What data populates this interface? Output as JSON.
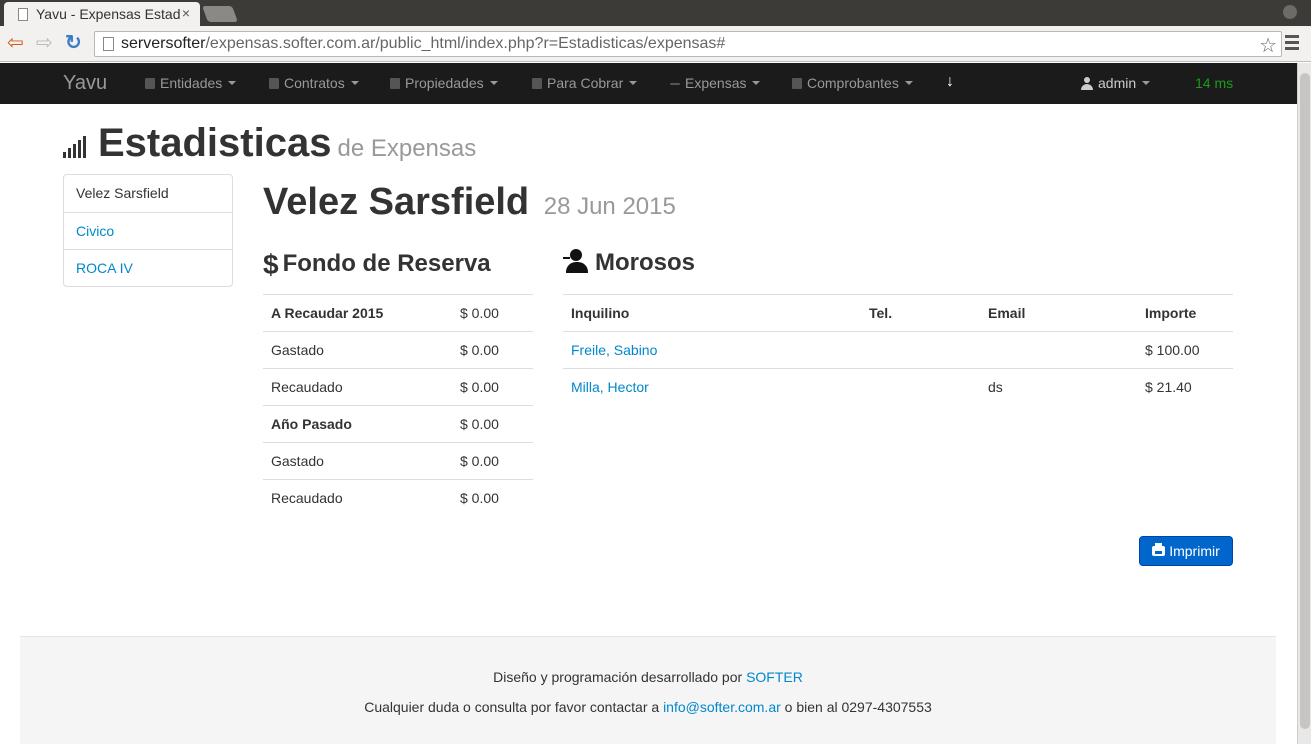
{
  "browser": {
    "tab_title": "Yavu - Expensas Estadisticas",
    "tab_close": "×",
    "url_host": "serversofter",
    "url_path": "/expensas.softer.com.ar/public_html/index.php?r=Estadisticas/expensas#",
    "back_icon": "arrow-left-icon",
    "forward_icon": "arrow-right-icon",
    "reload_icon": "reload-icon",
    "star_icon": "star-icon",
    "star_glyph": "☆",
    "back_glyph": "⇦",
    "forward_glyph": "⇨",
    "reload_glyph": "↻"
  },
  "navbar": {
    "brand": "Yavu",
    "items": [
      {
        "label": "Entidades"
      },
      {
        "label": "Contratos"
      },
      {
        "label": "Propiedades"
      },
      {
        "label": "Para Cobrar"
      },
      {
        "label": "Expensas"
      },
      {
        "label": "Comprobantes"
      }
    ],
    "download_glyph": "↓",
    "user": "admin",
    "timing": "14 ms",
    "colors": {
      "background": "#1b1b1b",
      "timing": "#1a9c1a"
    }
  },
  "page": {
    "title": "Estadisticas",
    "subtitle": "de Expensas"
  },
  "sidebar": {
    "items": [
      {
        "label": "Velez Sarsfield"
      },
      {
        "label": "Civico"
      },
      {
        "label": "ROCA IV"
      }
    ]
  },
  "main": {
    "building": "Velez Sarsfield",
    "date": "28 Jun 2015",
    "fondo": {
      "title": "Fondo de Reserva",
      "rows": [
        {
          "label": "A Recaudar 2015",
          "value": "$ 0.00"
        },
        {
          "label": "Gastado",
          "value": "$ 0.00"
        },
        {
          "label": "Recaudado",
          "value": "$ 0.00"
        },
        {
          "label": "Año Pasado",
          "value": "$ 0.00"
        },
        {
          "label": "Gastado",
          "value": "$ 0.00"
        },
        {
          "label": "Recaudado",
          "value": "$ 0.00"
        }
      ]
    },
    "morosos": {
      "title": "Morosos",
      "headers": [
        "Inquilino",
        "Tel.",
        "Email",
        "Importe"
      ],
      "rows": [
        {
          "inquilino": "Freile, Sabino",
          "tel": "",
          "email": "",
          "importe": "$ 100.00"
        },
        {
          "inquilino": "Milla, Hector",
          "tel": "",
          "email": "ds",
          "importe": "$ 21.40"
        }
      ]
    },
    "print_label": "Imprimir",
    "colors": {
      "link": "#0088cc",
      "print_button": "#0066cc"
    }
  },
  "footer": {
    "line1_text": "Diseño y programación desarrollado por ",
    "line1_link": "SOFTER",
    "line2_text": "Cualquier duda o consulta por favor contactar a ",
    "line2_link": "info@softer.com.ar",
    "line2_suffix": " o bien al 0297-4307553"
  }
}
